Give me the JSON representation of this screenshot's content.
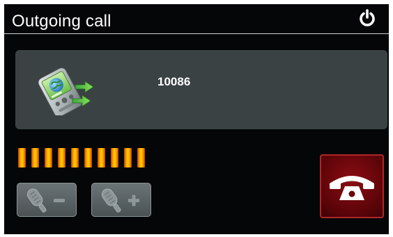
{
  "header": {
    "title": "Outgoing call",
    "power_icon": "power-icon"
  },
  "call": {
    "number": "10086",
    "icon": "outgoing-call-phone-icon"
  },
  "level_meter": {
    "bars_total": 10,
    "bars_lit": 10,
    "color": "#ffb000"
  },
  "controls": {
    "volume_down_icon": "microphone-volume-down-icon",
    "volume_up_icon": "microphone-volume-up-icon",
    "hangup_icon": "hang-up-icon"
  },
  "colors": {
    "background": "#050607",
    "panel": "#3b4244",
    "hangup": "#7a0a10",
    "text": "#ffffff"
  }
}
